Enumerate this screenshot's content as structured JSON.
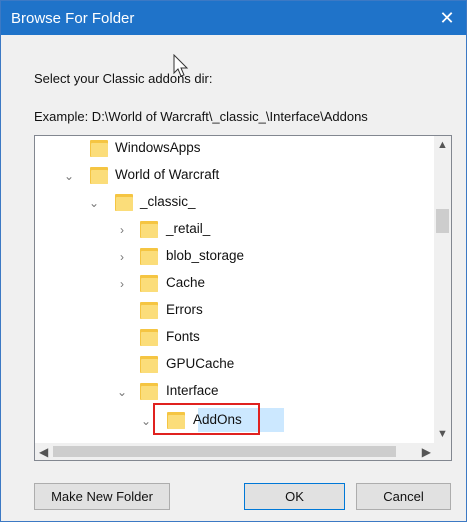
{
  "dialog": {
    "title": "Browse For Folder",
    "close_symbol": "✕",
    "instruction": "Select your Classic addons dir:",
    "example": "Example:  D:\\World of Warcraft\\_classic_\\Interface\\Addons"
  },
  "tree": {
    "items": [
      {
        "label": "WindowsApps",
        "expander": "",
        "level": 1
      },
      {
        "label": "World of Warcraft",
        "expander": "expanded",
        "level": 1
      },
      {
        "label": "_classic_",
        "expander": "expanded",
        "level": 2
      },
      {
        "label": "_retail_",
        "expander": "collapsed",
        "level": 3
      },
      {
        "label": "blob_storage",
        "expander": "collapsed",
        "level": 3
      },
      {
        "label": "Cache",
        "expander": "collapsed",
        "level": 3
      },
      {
        "label": "Errors",
        "expander": "",
        "level": 3
      },
      {
        "label": "Fonts",
        "expander": "",
        "level": 3
      },
      {
        "label": "GPUCache",
        "expander": "",
        "level": 3
      },
      {
        "label": "Interface",
        "expander": "expanded",
        "level": 3
      },
      {
        "label": "AddOns",
        "expander": "expanded",
        "level": 4,
        "selected": true
      }
    ]
  },
  "buttons": {
    "make_new_folder": "Make New Folder",
    "ok": "OK",
    "cancel": "Cancel"
  },
  "colors": {
    "titlebar": "#1f73c9",
    "selection": "#cce8ff",
    "highlight": "#e0211f"
  }
}
